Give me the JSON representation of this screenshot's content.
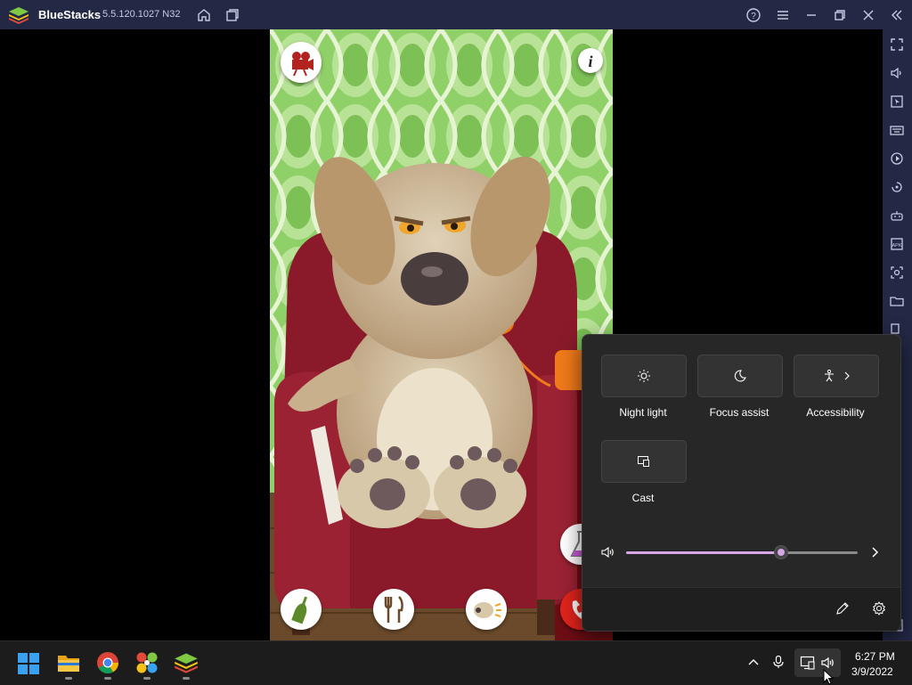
{
  "window": {
    "app_name": "BlueStacks",
    "version": "5.5.120.1027 N32"
  },
  "quick_settings": {
    "tiles": [
      {
        "label": "Night light"
      },
      {
        "label": "Focus assist"
      },
      {
        "label": "Accessibility"
      },
      {
        "label": "Cast"
      }
    ],
    "volume_level": 0.67
  },
  "taskbar": {
    "time": "6:27 PM",
    "date": "3/9/2022"
  },
  "colors": {
    "titlebar": "#232845",
    "slider_accent": "#d6a6e6",
    "taskbar": "#1c1c1c",
    "panel": "#272727"
  }
}
